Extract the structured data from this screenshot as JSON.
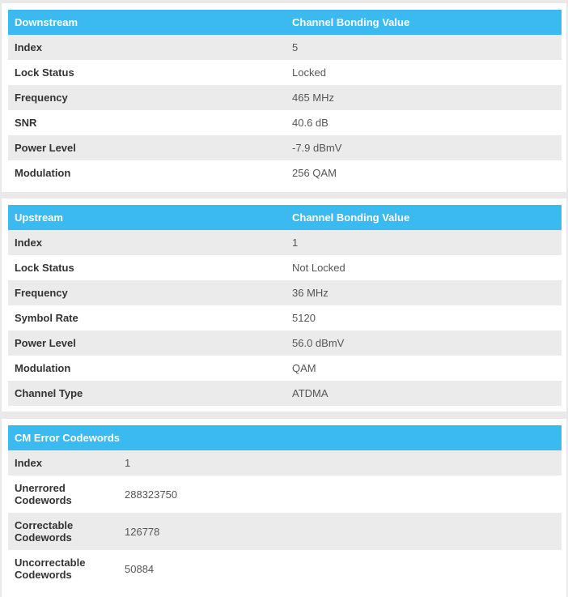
{
  "downstream": {
    "header": {
      "label": "Downstream",
      "value": "Channel Bonding Value"
    },
    "rows": [
      {
        "label": "Index",
        "value": "5"
      },
      {
        "label": "Lock Status",
        "value": "Locked"
      },
      {
        "label": "Frequency",
        "value": "465 MHz"
      },
      {
        "label": "SNR",
        "value": "40.6 dB"
      },
      {
        "label": "Power Level",
        "value": "-7.9 dBmV"
      },
      {
        "label": "Modulation",
        "value": "256 QAM"
      }
    ]
  },
  "upstream": {
    "header": {
      "label": "Upstream",
      "value": "Channel Bonding Value"
    },
    "rows": [
      {
        "label": "Index",
        "value": "1"
      },
      {
        "label": "Lock Status",
        "value": "Not Locked"
      },
      {
        "label": "Frequency",
        "value": "36 MHz"
      },
      {
        "label": "Symbol Rate",
        "value": "5120"
      },
      {
        "label": "Power Level",
        "value": "56.0 dBmV"
      },
      {
        "label": "Modulation",
        "value": "QAM"
      },
      {
        "label": "Channel Type",
        "value": "ATDMA"
      }
    ]
  },
  "cm_errors": {
    "header": {
      "label": "CM Error Codewords"
    },
    "rows": [
      {
        "label_line1": "Index",
        "label_line2": "",
        "value": "1"
      },
      {
        "label_line1": "Unerrored",
        "label_line2": "Codewords",
        "value": "288323750"
      },
      {
        "label_line1": "Correctable",
        "label_line2": "Codewords",
        "value": "126778"
      },
      {
        "label_line1": "Uncorrectable",
        "label_line2": "Codewords",
        "value": "50884"
      }
    ]
  },
  "colors": {
    "header_bg": "#3bbaf1",
    "stripe_bg": "#ebebeb",
    "page_bg": "#e9e9e9"
  }
}
